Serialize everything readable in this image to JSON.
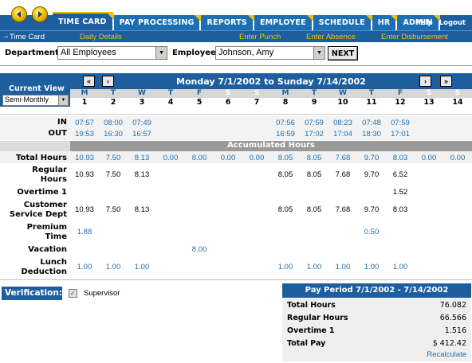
{
  "nav": {
    "tabs": [
      "TIME CARD",
      "PAY PROCESSING",
      "REPORTS",
      "EMPLOYEE",
      "SCHEDULE",
      "HR",
      "ADMIN"
    ],
    "active_tab": "TIME CARD",
    "help": "Help",
    "logout": "Logout"
  },
  "subnav": {
    "current": "Time Card",
    "items": [
      "Daily Details",
      "Enter Punch",
      "Enter Absence",
      "Enter Disbursement"
    ]
  },
  "filters": {
    "department_label": "Department",
    "department_value": "All Employees",
    "employee_label": "Employee",
    "employee_value": "Johnson, Amy",
    "next_label": "NEXT"
  },
  "grid": {
    "current_view_label": "Current View",
    "current_view_value": "Semi-Monthly",
    "period_title": "Monday 7/1/2002 to Sunday 7/14/2002",
    "btn_first": "«",
    "btn_prev": "‹",
    "btn_next": "›",
    "btn_last": "»",
    "days_of_week": [
      "M",
      "T",
      "W",
      "T",
      "F",
      "S",
      "S",
      "M",
      "T",
      "W",
      "T",
      "F",
      "S",
      "S"
    ],
    "dates": [
      "1",
      "2",
      "3",
      "4",
      "5",
      "6",
      "7",
      "8",
      "9",
      "10",
      "11",
      "12",
      "13",
      "14"
    ],
    "in_label": "IN",
    "out_label": "OUT",
    "in_times": [
      "07:57",
      "08:00",
      "07:49",
      "",
      "",
      "",
      "",
      "07:56",
      "07:59",
      "08:23",
      "07:48",
      "07:59",
      "",
      ""
    ],
    "out_times": [
      "19:53",
      "16:30",
      "16:57",
      "",
      "",
      "",
      "",
      "16:59",
      "17:02",
      "17:04",
      "18:30",
      "17:01",
      "",
      ""
    ],
    "accumulated_label": "Accumulated Hours",
    "rows": [
      {
        "label": [
          "Total Hours"
        ],
        "values": [
          "10.93",
          "7.50",
          "8.13",
          "0.00",
          "8.00",
          "0.00",
          "0.00",
          "8.05",
          "8.05",
          "7.68",
          "9.70",
          "8.03",
          "0.00",
          "0.00"
        ],
        "style": "blue"
      },
      {
        "label": [
          "Regular",
          "Hours"
        ],
        "values": [
          "10.93",
          "7.50",
          "8.13",
          "",
          "",
          "",
          "",
          "8.05",
          "8.05",
          "7.68",
          "9.70",
          "6.52",
          "",
          ""
        ],
        "style": "black"
      },
      {
        "label": [
          "Overtime 1"
        ],
        "values": [
          "",
          "",
          "",
          "",
          "",
          "",
          "",
          "",
          "",
          "",
          "",
          "1.52",
          "",
          ""
        ],
        "style": "black"
      },
      {
        "label": [
          "Customer",
          "Service Dept"
        ],
        "values": [
          "10.93",
          "7.50",
          "8.13",
          "",
          "",
          "",
          "",
          "8.05",
          "8.05",
          "7.68",
          "9.70",
          "8.03",
          "",
          ""
        ],
        "style": "black"
      },
      {
        "label": [
          "Premium",
          "Time"
        ],
        "values": [
          "1.88",
          "",
          "",
          "",
          "",
          "",
          "",
          "",
          "",
          "",
          "0.50",
          "",
          "",
          ""
        ],
        "style": "blue"
      },
      {
        "label": [
          "Vacation"
        ],
        "values": [
          "",
          "",
          "",
          "",
          "8.00",
          "",
          "",
          "",
          "",
          "",
          "",
          "",
          "",
          ""
        ],
        "style": "blue"
      },
      {
        "label": [
          "Lunch",
          "Deduction"
        ],
        "values": [
          "1.00",
          "1.00",
          "1.00",
          "",
          "",
          "",
          "",
          "1.00",
          "1.00",
          "1.00",
          "1.00",
          "1.00",
          "",
          ""
        ],
        "style": "blue"
      }
    ]
  },
  "verification": {
    "label": "Verification:",
    "checkbox_label": "Supervisor"
  },
  "pay_period": {
    "title": "Pay Period 7/1/2002 - 7/14/2002",
    "rows": [
      {
        "k": "Total Hours",
        "v": "76.082"
      },
      {
        "k": "Regular Hours",
        "v": "66.566"
      },
      {
        "k": "Overtime 1",
        "v": "1.516"
      },
      {
        "k": "Total Pay",
        "v": "$ 412.42"
      }
    ],
    "recalculate": "Recalculate"
  },
  "colors": {
    "primary": "#1d5f9e",
    "accent": "#f0c000",
    "link": "#1d6fb2"
  }
}
